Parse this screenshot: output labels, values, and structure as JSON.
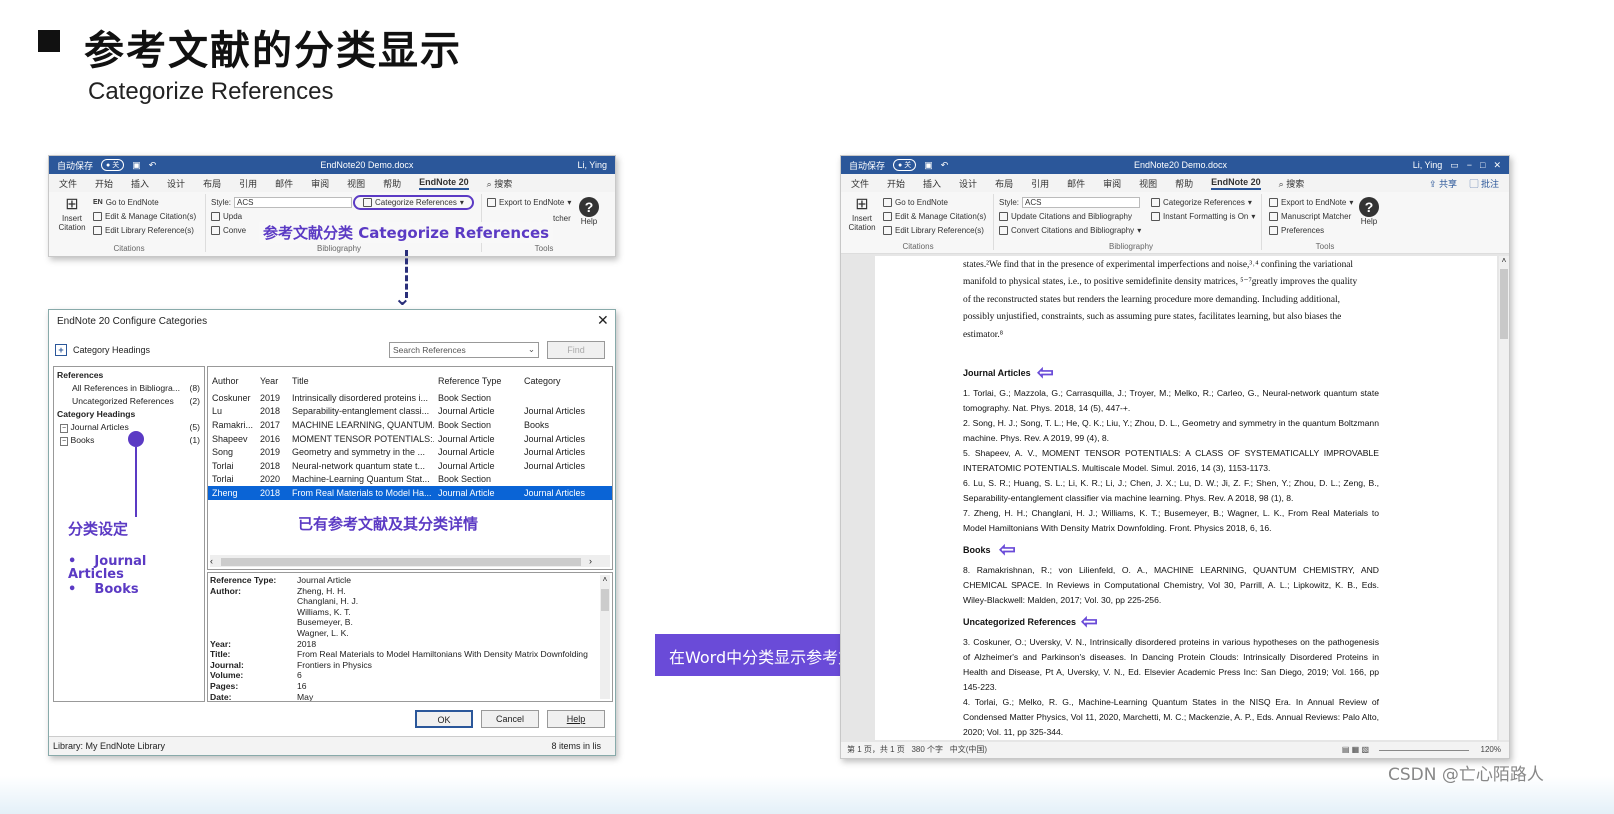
{
  "slide": {
    "title": "参考文献的分类显示",
    "subtitle": "Categorize References",
    "watermark": "CSDN @亡心陌路人"
  },
  "left_word": {
    "autosave": "自动保存",
    "autosave_state": "关",
    "title": "EndNote20 Demo.docx",
    "user": "Li, Ying",
    "menu": [
      "文件",
      "开始",
      "插入",
      "设计",
      "布局",
      "引用",
      "邮件",
      "审阅",
      "视图",
      "帮助",
      "EndNote 20",
      "搜索"
    ],
    "ribbon": {
      "insert_citation": "Insert Citation",
      "go_to": "Go to EndNote",
      "edit_manage": "Edit & Manage Citation(s)",
      "edit_library": "Edit Library Reference(s)",
      "style_label": "Style:",
      "style_value": "ACS",
      "update": "Upda",
      "convert": "Conve",
      "categorize": "Categorize References",
      "export": "Export to EndNote",
      "matcher": "tcher",
      "help": "Help",
      "grp_citations": "Citations",
      "grp_bibliography": "Bibliography",
      "grp_tools": "Tools"
    }
  },
  "callout_categorize": "参考文献分类 Categorize References",
  "dialog": {
    "title": "EndNote 20 Configure Categories",
    "category_headings_btn": "Category Headings",
    "search_placeholder": "Search References",
    "find": "Find",
    "tree": {
      "references": "References",
      "all_refs": "All References in Bibliogra...",
      "all_count": "(8)",
      "uncat": "Uncategorized References",
      "uncat_count": "(2)",
      "cat_headings": "Category Headings",
      "journal": "Journal Articles",
      "journal_count": "(5)",
      "books": "Books",
      "books_count": "(1)"
    },
    "columns": [
      "Author",
      "Year",
      "Title",
      "Reference Type",
      "Category"
    ],
    "rows": [
      [
        "Coskuner",
        "2019",
        "Intrinsically disordered proteins i...",
        "Book Section",
        ""
      ],
      [
        "Lu",
        "2018",
        "Separability-entanglement classi...",
        "Journal Article",
        "Journal Articles"
      ],
      [
        "Ramakri...",
        "2017",
        "MACHINE LEARNING, QUANTUM...",
        "Book Section",
        "Books"
      ],
      [
        "Shapeev",
        "2016",
        "MOMENT TENSOR POTENTIALS:...",
        "Journal Article",
        "Journal Articles"
      ],
      [
        "Song",
        "2019",
        "Geometry and symmetry in the ...",
        "Journal Article",
        "Journal Articles"
      ],
      [
        "Torlai",
        "2018",
        "Neural-network quantum state t...",
        "Journal Article",
        "Journal Articles"
      ],
      [
        "Torlai",
        "2020",
        "Machine-Learning Quantum Stat...",
        "Book Section",
        ""
      ],
      [
        "Zheng",
        "2018",
        "From Real Materials to Model Ha...",
        "Journal Article",
        "Journal Articles"
      ]
    ],
    "detail": {
      "ref_type_label": "Reference Type:",
      "ref_type": "Journal Article",
      "author_label": "Author:",
      "authors": [
        "Zheng, H. H.",
        "Changlani, H. J.",
        "Williams, K. T.",
        "Busemeyer, B.",
        "Wagner, L. K."
      ],
      "year_label": "Year:",
      "year": "2018",
      "title_label": "Title:",
      "title": "From Real Materials to Model Hamiltonians With Density Matrix Downfolding",
      "journal_label": "Journal:",
      "journal": "Frontiers in Physics",
      "volume_label": "Volume:",
      "volume": "6",
      "pages_label": "Pages:",
      "pages": "16",
      "date_label": "Date:",
      "date": "May"
    },
    "ok": "OK",
    "cancel": "Cancel",
    "help": "Help",
    "library": "Library: My EndNote Library",
    "items": "8 items in lis"
  },
  "annot_setting": {
    "title": "分类设定",
    "items": [
      "Journal Articles",
      "Books"
    ]
  },
  "annot_details": "已有参考文献及其分类详情",
  "banner": "在Word中分类显示参考文献信息",
  "right_word": {
    "autosave": "自动保存",
    "autosave_state": "关",
    "title": "EndNote20 Demo.docx",
    "user": "Li, Ying",
    "menu": [
      "文件",
      "开始",
      "插入",
      "设计",
      "布局",
      "引用",
      "邮件",
      "审阅",
      "视图",
      "帮助",
      "EndNote 20",
      "搜索"
    ],
    "share": "共享",
    "comment": "批注",
    "ribbon": {
      "insert_citation": "Insert Citation",
      "go_to": "Go to EndNote",
      "edit_manage": "Edit & Manage Citation(s)",
      "edit_library": "Edit Library Reference(s)",
      "style_label": "Style:",
      "style_value": "ACS",
      "update": "Update Citations and Bibliography",
      "convert": "Convert Citations and Bibliography",
      "categorize": "Categorize References",
      "instant": "Instant Formatting is On",
      "export": "Export to EndNote",
      "matcher": "Manuscript Matcher",
      "prefs": "Preferences",
      "help": "Help",
      "grp_citations": "Citations",
      "grp_bibliography": "Bibliography",
      "grp_tools": "Tools"
    },
    "body_intro": [
      "states.²We find that in the presence of experimental imperfections and noise,³˒⁴ confining the variational",
      "manifold to physical states, i.e., to positive semidefinite density matrices, ⁵⁻⁷greatly improves the quality",
      "of the reconstructed states but renders the learning procedure more demanding. Including additional,",
      "possibly unjustified, constraints, such as assuming pure states, facilitates learning, but also biases the",
      "estimator.⁸"
    ],
    "sec_journal": "Journal Articles",
    "journal_refs": [
      "1.   Torlai, G.;   Mazzola, G.;   Carrasquilla, J.;   Troyer, M.;   Melko, R.; Carleo, G., Neural-network quantum state tomography. Nat. Phys. 2018, 14 (5), 447-+.",
      "2.   Song, H. J.;   Song, T. L.;   He, Q. K.;   Liu, Y.; Zhou, D. L., Geometry and symmetry in the quantum Boltzmann machine. Phys. Rev. A 2019, 99 (4), 8.",
      "5.   Shapeev, A. V., MOMENT TENSOR POTENTIALS: A CLASS OF SYSTEMATICALLY IMPROVABLE INTERATOMIC POTENTIALS. Multiscale Model. Simul. 2016, 14 (3), 1153-1173.",
      "6.   Lu, S. R.;   Huang, S. L.;   Li, K. R.;   Li, J.;   Chen, J. X.;   Lu, D. W.;   Ji, Z. F.;   Shen, Y.;   Zhou, D. L.; Zeng, B., Separability-entanglement classifier via machine learning. Phys. Rev. A 2018, 98 (1), 8.",
      "7.   Zheng, H. H.;   Changlani, H. J.;   Williams, K. T.;   Busemeyer, B.; Wagner, L. K., From Real Materials to Model Hamiltonians With Density Matrix Downfolding. Front. Physics 2018, 6, 16."
    ],
    "sec_books": "Books",
    "book_refs": [
      "8.   Ramakrishnan, R.; von Lilienfeld, O. A., MACHINE LEARNING, QUANTUM CHEMISTRY, AND CHEMICAL SPACE. In Reviews in Computational Chemistry, Vol 30, Parrill, A. L.; Lipkowitz, K. B., Eds. Wiley-Blackwell: Malden, 2017; Vol. 30, pp 225-256."
    ],
    "sec_uncat": "Uncategorized References",
    "uncat_refs": [
      "3.   Coskuner, O.; Uversky, V. N., Intrinsically disordered proteins in various hypotheses on the pathogenesis of Alzheimer's and Parkinson's diseases. In Dancing Protein Clouds: Intrinsically Disordered Proteins in Health and Disease, Pt A, Uversky, V. N., Ed. Elsevier Academic Press Inc: San Diego, 2019; Vol. 166, pp 145-223.",
      "4.   Torlai, G.; Melko, R. G., Machine-Learning Quantum States in the NISQ Era. In Annual Review of Condensed Matter Physics, Vol 11, 2020, Marchetti, M. C.; Mackenzie, A. P., Eds. Annual Reviews: Palo Alto, 2020; Vol. 11, pp 325-344."
    ],
    "status": {
      "page": "第 1 页，共 1 页",
      "words": "380 个字",
      "lang": "中文(中国)",
      "zoom": "120%"
    }
  }
}
